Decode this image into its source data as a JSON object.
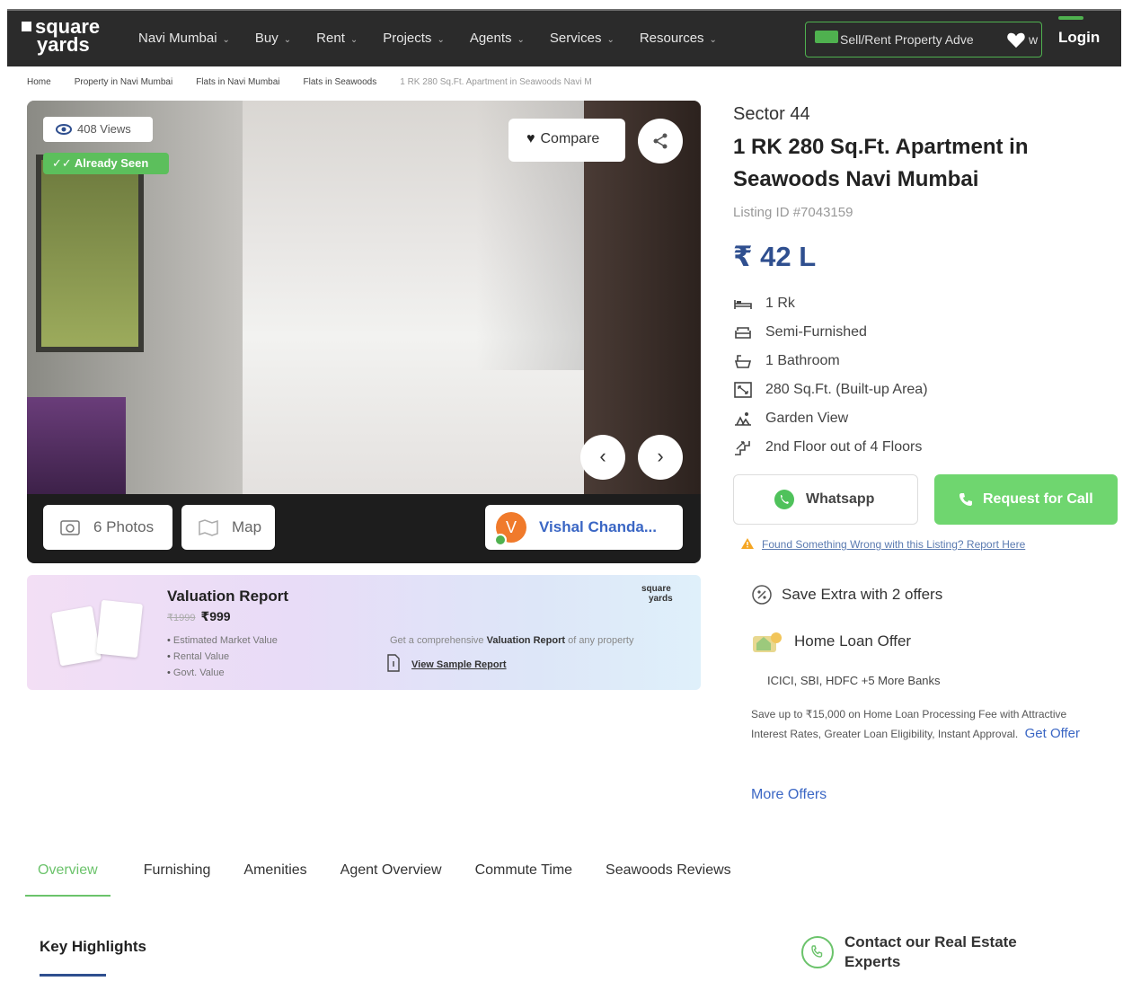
{
  "header": {
    "logo_line1": "square",
    "logo_line2": "yards",
    "nav": [
      "Navi Mumbai",
      "Buy",
      "Rent",
      "Projects",
      "Agents",
      "Services",
      "Resources"
    ],
    "sell_label": "Sell/Rent Property Adve",
    "sell_suffix": "w",
    "login": "Login"
  },
  "breadcrumb": [
    "Home",
    "Property in Navi Mumbai",
    "Flats in Navi Mumbai",
    "Flats in Seawoods",
    "1 RK 280 Sq.Ft. Apartment in Seawoods Navi M"
  ],
  "gallery": {
    "views": "408 Views",
    "seen": "Already Seen",
    "compare": "Compare",
    "photos": "6 Photos",
    "map": "Map",
    "agent_initial": "V",
    "agent_name": "Vishal Chanda..."
  },
  "valuation": {
    "title": "Valuation Report",
    "old_price": "₹1999",
    "price": "₹999",
    "bullets": [
      "Estimated Market Value",
      "Rental Value",
      "Govt. Value"
    ],
    "desc_pre": "Get a comprehensive ",
    "desc_bold": "Valuation Report",
    "desc_post": " of any property",
    "sample_link": "View Sample Report",
    "logo_line1": "square",
    "logo_line2": "yards"
  },
  "listing": {
    "sector": "Sector 44",
    "title": "1 RK 280 Sq.Ft. Apartment in Seawoods Navi Mumbai",
    "listing_id": "Listing ID #7043159",
    "price": "₹ 42 L",
    "facts": [
      {
        "icon": "bed-icon",
        "text": "1 Rk"
      },
      {
        "icon": "sofa-icon",
        "text": "Semi-Furnished"
      },
      {
        "icon": "bathtub-icon",
        "text": "1 Bathroom"
      },
      {
        "icon": "area-icon",
        "text": "280 Sq.Ft. (Built-up Area)"
      },
      {
        "icon": "garden-icon",
        "text": "Garden View"
      },
      {
        "icon": "floor-icon",
        "text": "2nd Floor out of 4 Floors"
      }
    ],
    "whatsapp": "Whatsapp",
    "request_call": "Request for Call",
    "report_wrong": "Found Something Wrong with this Listing? Report Here"
  },
  "offers": {
    "heading": "Save Extra with 2 offers",
    "loan_heading": "Home Loan Offer",
    "banks": "ICICI, SBI, HDFC +5 More Banks",
    "desc": "Save up to ₹15,000 on Home Loan Processing Fee with Attractive Interest Rates, Greater Loan Eligibility, Instant Approval.",
    "get_offer": "Get Offer",
    "more_offers": "More Offers"
  },
  "tabs": [
    "Overview",
    "Furnishing",
    "Amenities",
    "Agent Overview",
    "Commute Time",
    "Seawoods Reviews"
  ],
  "active_tab": "Overview",
  "section": {
    "key_highlights": "Key Highlights",
    "contact": "Contact our Real Estate Experts"
  },
  "colors": {
    "header_bg": "#2b2b2b",
    "accent_green": "#6bc36b",
    "price_blue": "#2f4f8f",
    "link_blue": "#3a66c4"
  }
}
